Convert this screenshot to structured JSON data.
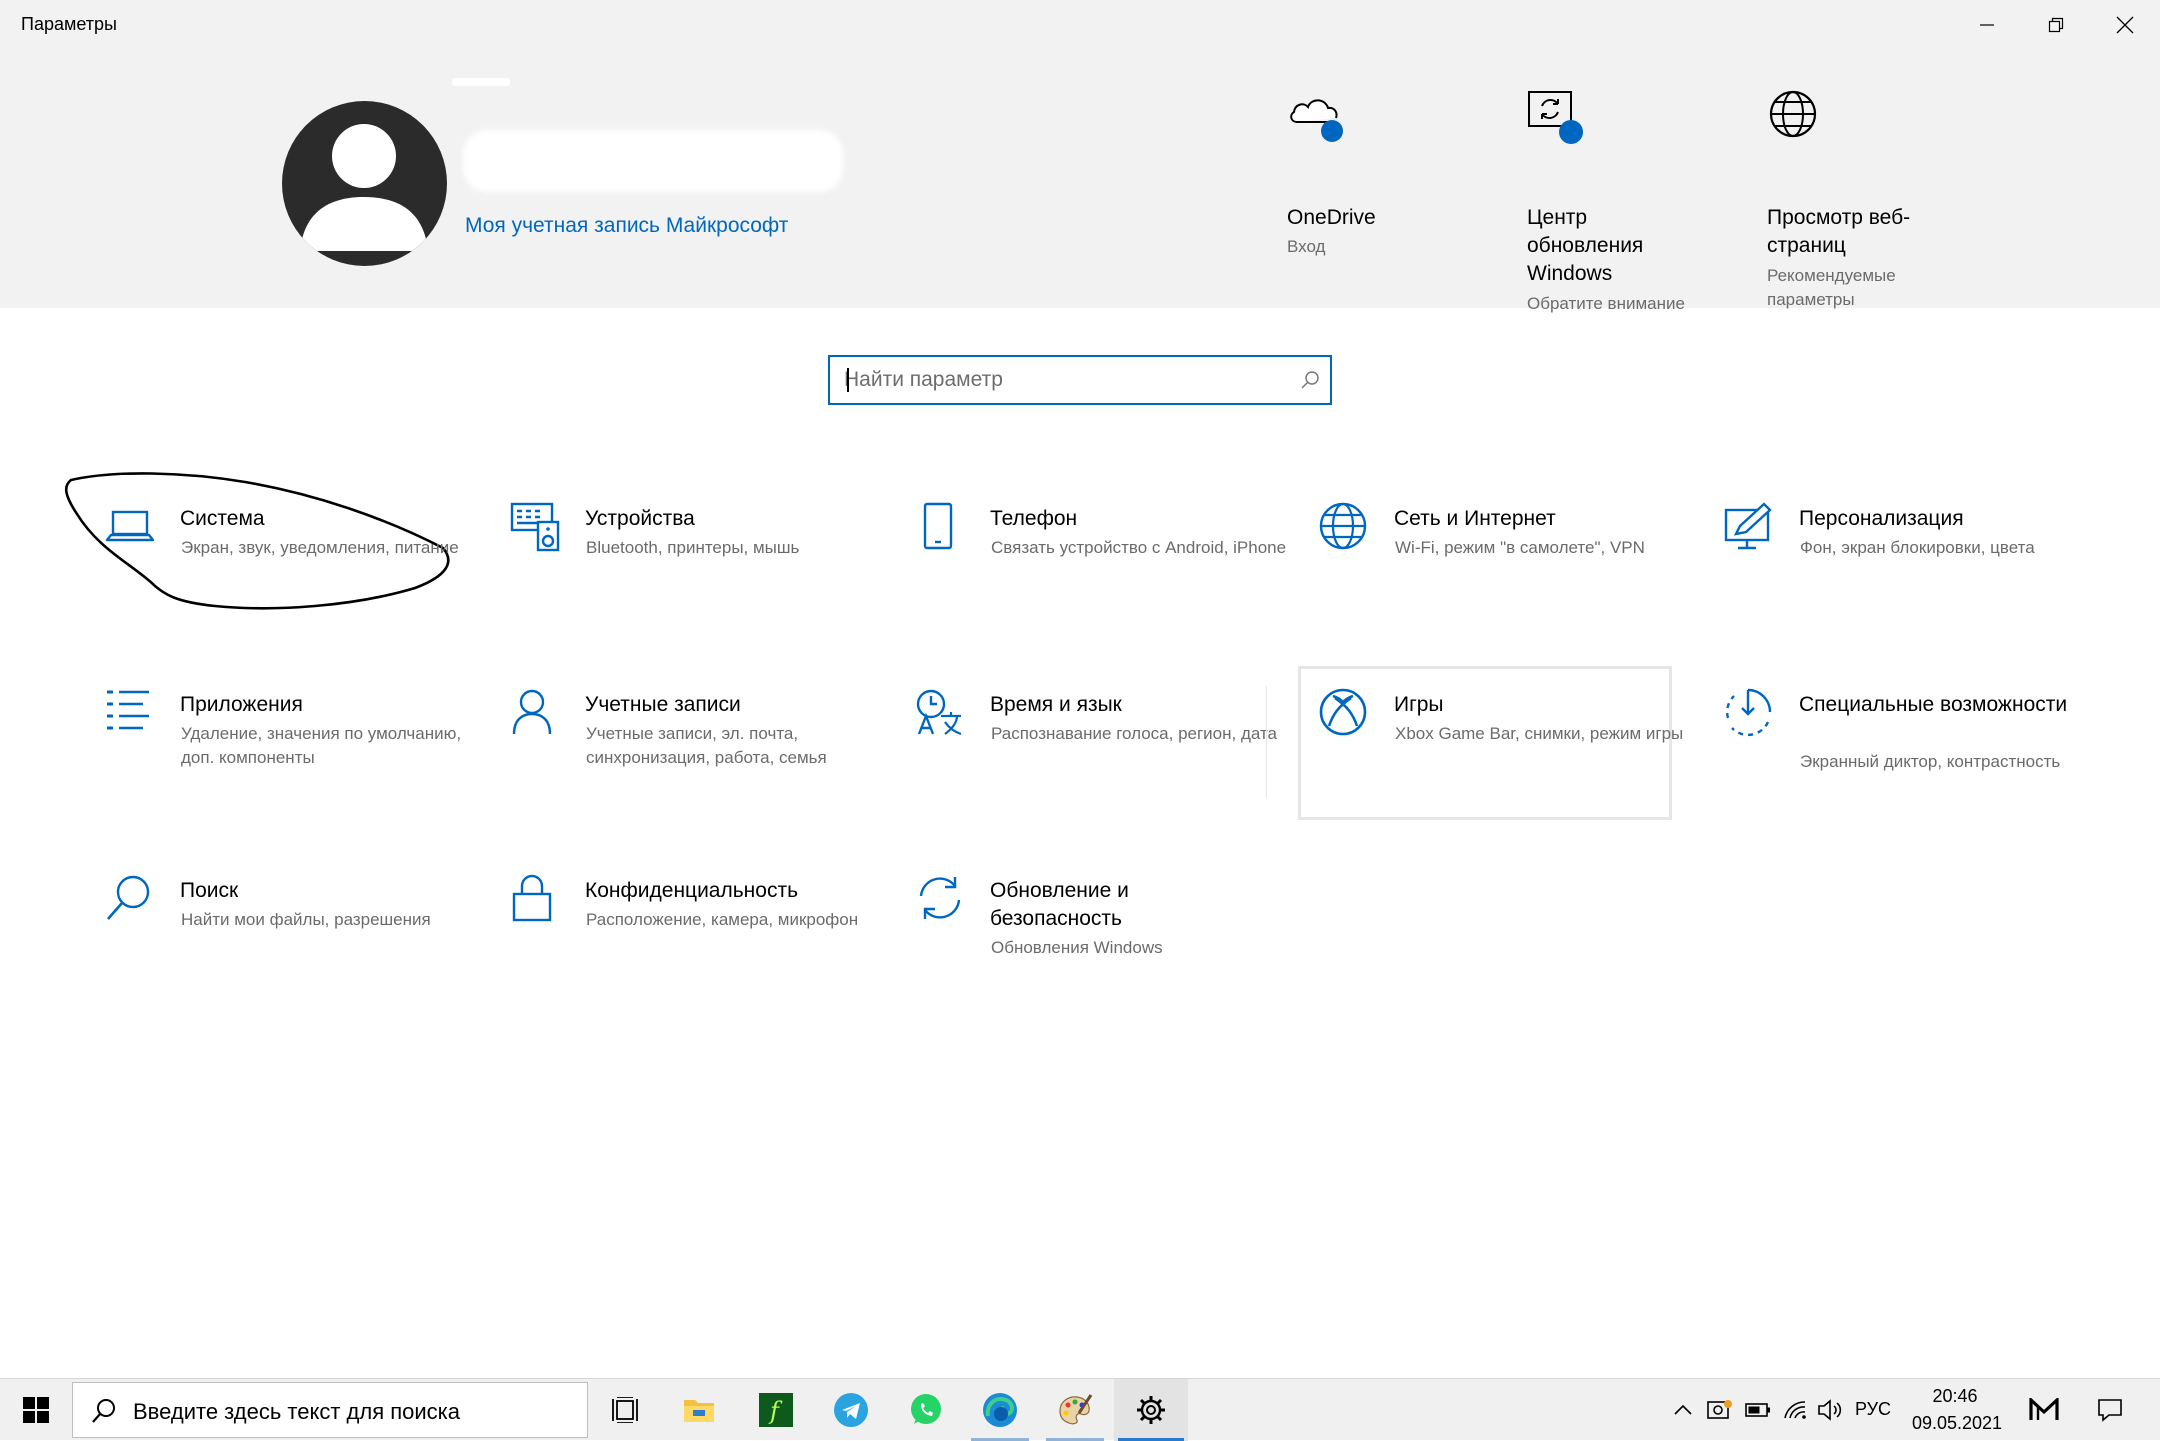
{
  "window": {
    "title": "Параметры",
    "controls": [
      "minimize",
      "restore",
      "close"
    ]
  },
  "account": {
    "link_label": "Моя учетная запись Майкрософт"
  },
  "quick_actions": [
    {
      "icon": "onedrive-icon",
      "title": "OneDrive",
      "subtitle": "Вход"
    },
    {
      "icon": "windows-update-icon",
      "title": "Центр\nобновления\nWindows",
      "subtitle": "Обратите внимание"
    },
    {
      "icon": "globe-icon",
      "title": "Просмотр веб-\nстраниц",
      "subtitle": "Рекомендуемые\nпараметры"
    }
  ],
  "search": {
    "placeholder": "Найти параметр"
  },
  "tiles": [
    {
      "icon": "laptop-icon",
      "title": "Система",
      "desc": "Экран, звук, уведомления, питание"
    },
    {
      "icon": "devices-icon",
      "title": "Устройства",
      "desc": "Bluetooth, принтеры, мышь"
    },
    {
      "icon": "phone-icon",
      "title": "Телефон",
      "desc": "Связать устройство с Android, iPhone"
    },
    {
      "icon": "globe-icon",
      "title": "Сеть и Интернет",
      "desc": "Wi-Fi, режим \"в самолете\", VPN"
    },
    {
      "icon": "personalization-icon",
      "title": "Персонализация",
      "desc": "Фон, экран блокировки, цвета"
    },
    {
      "icon": "apps-list-icon",
      "title": "Приложения",
      "desc": "Удаление, значения по умолчанию, доп. компоненты"
    },
    {
      "icon": "person-icon",
      "title": "Учетные записи",
      "desc": "Учетные записи, эл. почта, синхронизация, работа, семья"
    },
    {
      "icon": "time-language-icon",
      "title": "Время и язык",
      "desc": "Распознавание голоса, регион, дата"
    },
    {
      "icon": "xbox-icon",
      "title": "Игры",
      "desc": "Xbox Game Bar, снимки, режим игры"
    },
    {
      "icon": "accessibility-icon",
      "title": "Специальные возможности",
      "desc": "Экранный диктор, контрастность"
    },
    {
      "icon": "search-icon",
      "title": "Поиск",
      "desc": "Найти мои файлы, разрешения"
    },
    {
      "icon": "lock-icon",
      "title": "Конфиденциальность",
      "desc": "Расположение, камера, микрофон"
    },
    {
      "icon": "sync-icon",
      "title": "Обновление и безопасность",
      "desc": "Обновления Windows"
    }
  ],
  "taskbar": {
    "search_placeholder": "Введите здесь текст для поиска",
    "apps": [
      "task-view-icon",
      "file-explorer-icon",
      "fl-studio-icon",
      "telegram-icon",
      "whatsapp-icon",
      "edge-icon",
      "paint-icon",
      "settings-gear-icon"
    ],
    "language": "РУС",
    "time": "20:46",
    "date": "09.05.2021"
  },
  "colors": {
    "accent": "#0067c0",
    "header_bg": "#f2f2f2",
    "secondary_text": "#6b6b6b"
  }
}
